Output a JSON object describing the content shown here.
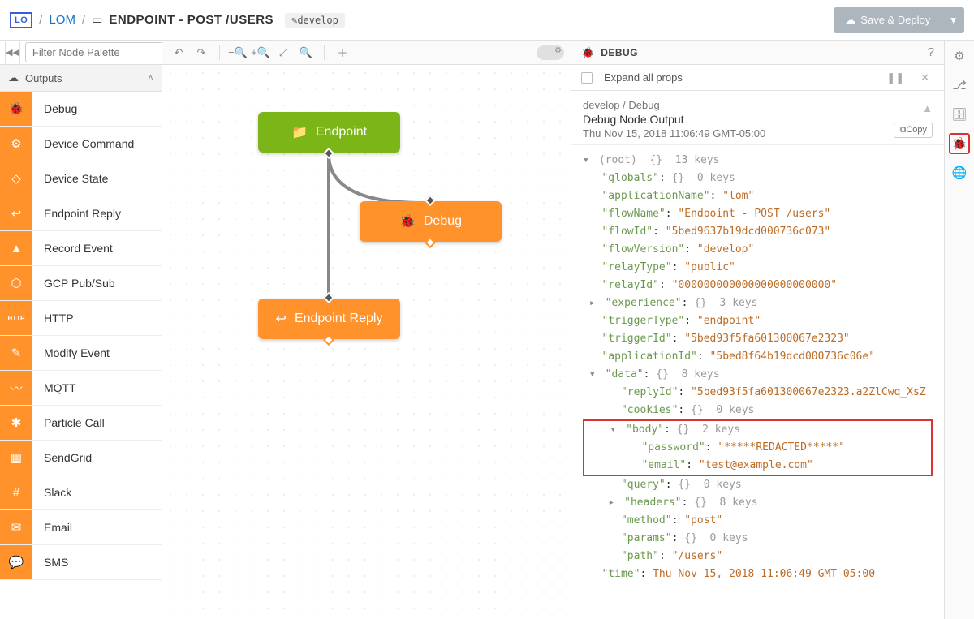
{
  "header": {
    "logo": "LO",
    "bc_app": "LOM",
    "bc_title": "ENDPOINT - POST /USERS",
    "bc_branch": "develop",
    "save": "Save & Deploy"
  },
  "palette": {
    "filter_ph": "Filter Node Palette",
    "category": "Outputs",
    "items": [
      {
        "label": "Debug",
        "icon": "🐞"
      },
      {
        "label": "Device Command",
        "icon": "⚙"
      },
      {
        "label": "Device State",
        "icon": "◇"
      },
      {
        "label": "Endpoint Reply",
        "icon": "↩"
      },
      {
        "label": "Record Event",
        "icon": "▲"
      },
      {
        "label": "GCP Pub/Sub",
        "icon": "⬡"
      },
      {
        "label": "HTTP",
        "icon": "HTTP"
      },
      {
        "label": "Modify Event",
        "icon": "✎"
      },
      {
        "label": "MQTT",
        "icon": "〰"
      },
      {
        "label": "Particle Call",
        "icon": "✱"
      },
      {
        "label": "SendGrid",
        "icon": "▦"
      },
      {
        "label": "Slack",
        "icon": "#"
      },
      {
        "label": "Email",
        "icon": "✉"
      },
      {
        "label": "SMS",
        "icon": "💬"
      }
    ]
  },
  "canvas": {
    "endpoint": "Endpoint",
    "debug": "Debug",
    "reply": "Endpoint Reply"
  },
  "debug": {
    "title": "DEBUG",
    "expand": "Expand all props",
    "path": "develop / Debug",
    "nodeTitle": "Debug Node Output",
    "timestamp": "Thu Nov 15, 2018 11:06:49 GMT-05:00",
    "copy": "Copy",
    "root_meta": "(root)  {}  13 keys",
    "kv": {
      "globals": "{}  0 keys",
      "applicationName": "\"lom\"",
      "flowName": "\"Endpoint - POST /users\"",
      "flowId": "\"5bed9637b19dcd000736c073\"",
      "flowVersion": "\"develop\"",
      "relayType": "\"public\"",
      "relayId": "\"000000000000000000000000\"",
      "experience": "{}  3 keys",
      "triggerType": "\"endpoint\"",
      "triggerId": "\"5bed93f5fa601300067e2323\"",
      "applicationId": "\"5bed8f64b19dcd000736c06e\"",
      "data": "{}  8 keys",
      "replyId": "\"5bed93f5fa601300067e2323.a2ZlCwq_XsZ",
      "cookies": "{}  0 keys",
      "body": "{}  2 keys",
      "password": "\"*****REDACTED*****\"",
      "email": "\"test@example.com\"",
      "query": "{}  0 keys",
      "headers": "{}  8 keys",
      "method": "\"post\"",
      "params": "{}  0 keys",
      "path": "\"/users\"",
      "time": "Thu Nov 15, 2018 11:06:49 GMT-05:00"
    }
  }
}
